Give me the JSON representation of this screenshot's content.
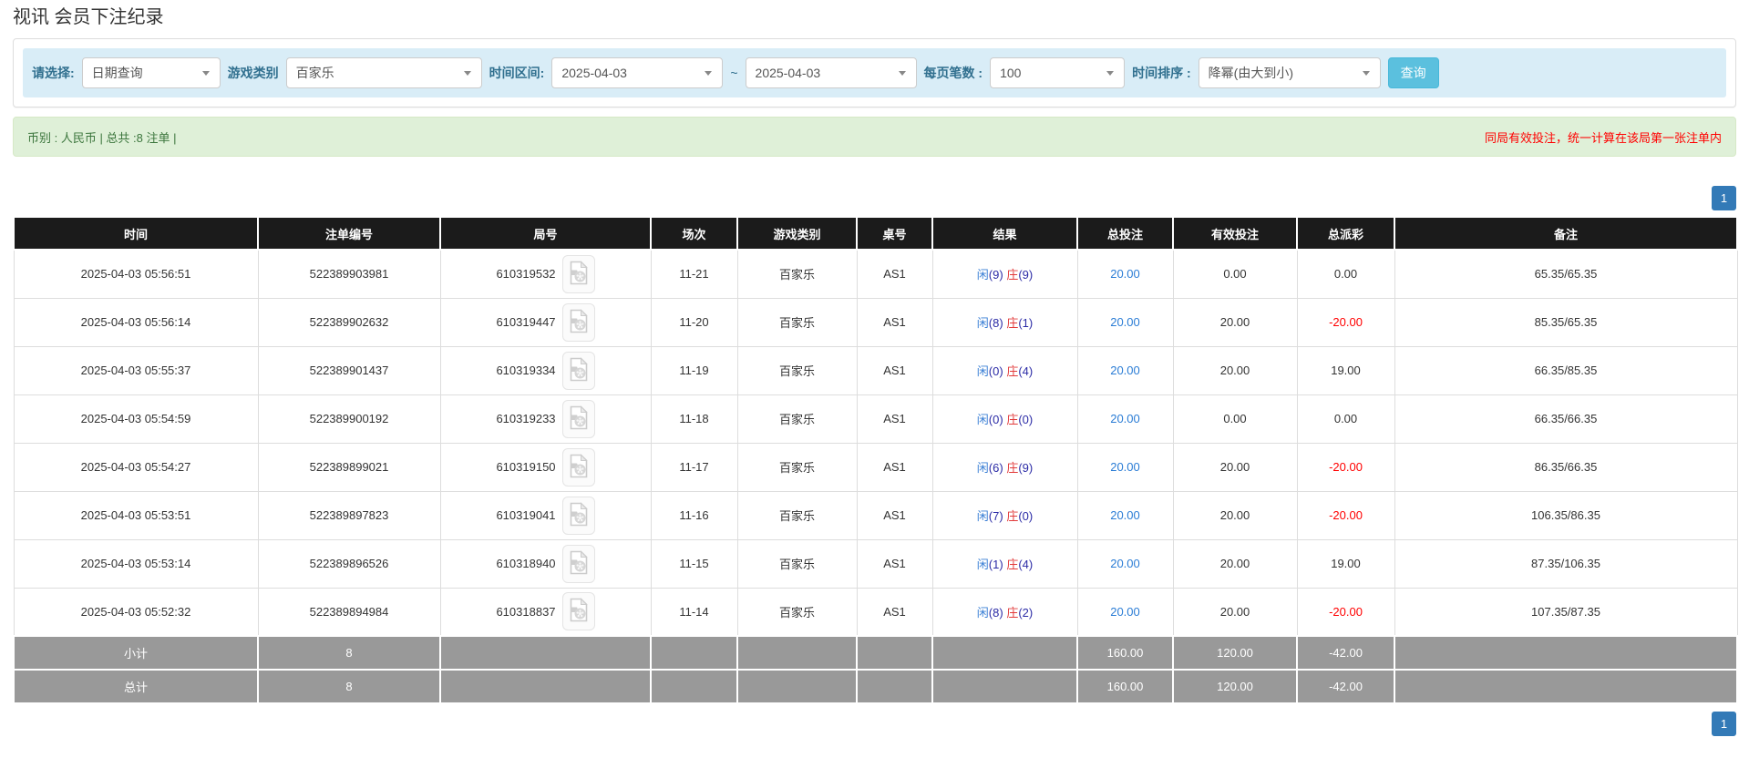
{
  "page": {
    "title": "视讯 会员下注纪录"
  },
  "filters": {
    "select_label": "请选择:",
    "select_value": "日期查询",
    "game_type_label": "游戏类别",
    "game_type_value": "百家乐",
    "time_range_label": "时间区间:",
    "date_from": "2025-04-03",
    "range_separator": "~",
    "date_to": "2025-04-03",
    "page_size_label": "每页笔数 :",
    "page_size_value": "100",
    "sort_label": "时间排序 :",
    "sort_value": "降幂(由大到小)",
    "search_button": "查询"
  },
  "summary_bar": {
    "left": "币别 : 人民币 | 总共 :8 注单 |",
    "right": "同局有效投注，统一计算在该局第一张注单内"
  },
  "pagination": {
    "page": "1"
  },
  "table": {
    "headers": [
      "时间",
      "注单编号",
      "局号",
      "场次",
      "游戏类别",
      "桌号",
      "结果",
      "总投注",
      "有效投注",
      "总派彩",
      "备注"
    ],
    "rows": [
      {
        "time": "2025-04-03 05:56:51",
        "bet_id": "522389903981",
        "round_id": "610319532",
        "session": "11-21",
        "game": "百家乐",
        "table_no": "AS1",
        "result": {
          "p": "闲",
          "pn": "(9)",
          "b": "庄",
          "bn": "(9)"
        },
        "total_bet": "20.00",
        "valid_bet": "0.00",
        "payout": "0.00",
        "note": "65.35/65.35"
      },
      {
        "time": "2025-04-03 05:56:14",
        "bet_id": "522389902632",
        "round_id": "610319447",
        "session": "11-20",
        "game": "百家乐",
        "table_no": "AS1",
        "result": {
          "p": "闲",
          "pn": "(8)",
          "b": "庄",
          "bn": "(1)"
        },
        "total_bet": "20.00",
        "valid_bet": "20.00",
        "payout": "-20.00",
        "note": "85.35/65.35"
      },
      {
        "time": "2025-04-03 05:55:37",
        "bet_id": "522389901437",
        "round_id": "610319334",
        "session": "11-19",
        "game": "百家乐",
        "table_no": "AS1",
        "result": {
          "p": "闲",
          "pn": "(0)",
          "b": "庄",
          "bn": "(4)"
        },
        "total_bet": "20.00",
        "valid_bet": "20.00",
        "payout": "19.00",
        "note": "66.35/85.35"
      },
      {
        "time": "2025-04-03 05:54:59",
        "bet_id": "522389900192",
        "round_id": "610319233",
        "session": "11-18",
        "game": "百家乐",
        "table_no": "AS1",
        "result": {
          "p": "闲",
          "pn": "(0)",
          "b": "庄",
          "bn": "(0)"
        },
        "total_bet": "20.00",
        "valid_bet": "0.00",
        "payout": "0.00",
        "note": "66.35/66.35"
      },
      {
        "time": "2025-04-03 05:54:27",
        "bet_id": "522389899021",
        "round_id": "610319150",
        "session": "11-17",
        "game": "百家乐",
        "table_no": "AS1",
        "result": {
          "p": "闲",
          "pn": "(6)",
          "b": "庄",
          "bn": "(9)"
        },
        "total_bet": "20.00",
        "valid_bet": "20.00",
        "payout": "-20.00",
        "note": "86.35/66.35"
      },
      {
        "time": "2025-04-03 05:53:51",
        "bet_id": "522389897823",
        "round_id": "610319041",
        "session": "11-16",
        "game": "百家乐",
        "table_no": "AS1",
        "result": {
          "p": "闲",
          "pn": "(7)",
          "b": "庄",
          "bn": "(0)"
        },
        "total_bet": "20.00",
        "valid_bet": "20.00",
        "payout": "-20.00",
        "note": "106.35/86.35"
      },
      {
        "time": "2025-04-03 05:53:14",
        "bet_id": "522389896526",
        "round_id": "610318940",
        "session": "11-15",
        "game": "百家乐",
        "table_no": "AS1",
        "result": {
          "p": "闲",
          "pn": "(1)",
          "b": "庄",
          "bn": "(4)"
        },
        "total_bet": "20.00",
        "valid_bet": "20.00",
        "payout": "19.00",
        "note": "87.35/106.35"
      },
      {
        "time": "2025-04-03 05:52:32",
        "bet_id": "522389894984",
        "round_id": "610318837",
        "session": "11-14",
        "game": "百家乐",
        "table_no": "AS1",
        "result": {
          "p": "闲",
          "pn": "(8)",
          "b": "庄",
          "bn": "(2)"
        },
        "total_bet": "20.00",
        "valid_bet": "20.00",
        "payout": "-20.00",
        "note": "107.35/87.35"
      }
    ],
    "summary_rows": [
      {
        "label": "小计",
        "count": "8",
        "total_bet": "160.00",
        "valid_bet": "120.00",
        "payout": "-42.00",
        "note": ""
      },
      {
        "label": "总计",
        "count": "8",
        "total_bet": "160.00",
        "valid_bet": "120.00",
        "payout": "-42.00",
        "note": ""
      }
    ],
    "colors": {
      "header_bg": "#1b1b1b",
      "summary_bg": "#999999",
      "link_blue": "#2a7cd5",
      "negative_red": "#ff0000",
      "player_blue": "#3a7fd5",
      "banker_red": "#e23b3b",
      "accent_search": "#5bc0de",
      "pager_blue": "#337ab7",
      "filter_bg": "#d9edf7",
      "alert_bg": "#dff0d8"
    }
  }
}
